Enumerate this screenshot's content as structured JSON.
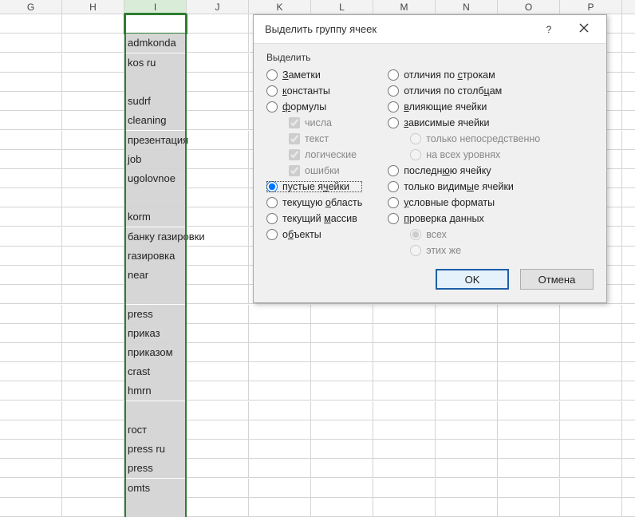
{
  "columns": [
    "G",
    "H",
    "I",
    "J",
    "K",
    "L",
    "M",
    "N",
    "O",
    "P",
    ""
  ],
  "selected_column_index": 2,
  "rows": 26,
  "cells": {
    "I": [
      "",
      "admkonda",
      "kos ru",
      "",
      "sudrf",
      "cleaning",
      "презентация",
      "job",
      "ugolovnoe",
      "",
      "korm",
      "банку газировки",
      "газировка",
      "near",
      "",
      "press",
      "приказ",
      "приказом",
      "crast",
      "hmrn",
      "",
      "гост",
      "press ru",
      "press",
      "omts",
      ""
    ]
  },
  "active_cell": {
    "col": "I",
    "row": 0
  },
  "dialog": {
    "title": "Выделить группу ячеек",
    "help": "?",
    "group_label": "Выделить",
    "left_options": [
      {
        "label": "Заметки",
        "hot": "З",
        "type": "radio",
        "checked": false
      },
      {
        "label": "константы",
        "hot": "к",
        "type": "radio",
        "checked": false
      },
      {
        "label": "формулы",
        "hot": "ф",
        "type": "radio",
        "checked": false
      },
      {
        "label": "числа",
        "type": "check",
        "indent": true,
        "checked": true,
        "disabled": true
      },
      {
        "label": "текст",
        "type": "check",
        "indent": true,
        "checked": true,
        "disabled": true
      },
      {
        "label": "логические",
        "type": "check",
        "indent": true,
        "checked": true,
        "disabled": true
      },
      {
        "label": "ошибки",
        "type": "check",
        "indent": true,
        "checked": true,
        "disabled": true
      },
      {
        "label": "пустые ячейки",
        "hot": "ч",
        "type": "radio",
        "checked": true,
        "outlined": true
      },
      {
        "label": "текущую область",
        "hot": "о",
        "type": "radio",
        "checked": false
      },
      {
        "label": "текущий массив",
        "hot": "м",
        "type": "radio",
        "checked": false
      },
      {
        "label": "объекты",
        "hot": "б",
        "type": "radio",
        "checked": false
      }
    ],
    "right_options": [
      {
        "label": "отличия по строкам",
        "hot": "с",
        "type": "radio",
        "checked": false
      },
      {
        "label": "отличия по столбцам",
        "hot": "ц",
        "type": "radio",
        "checked": false
      },
      {
        "label": "влияющие ячейки",
        "hot": "в",
        "type": "radio",
        "checked": false
      },
      {
        "label": "зависимые ячейки",
        "hot": "з",
        "type": "radio",
        "checked": false
      },
      {
        "label": "только непосредственно",
        "type": "radio",
        "indent": true,
        "checked": true,
        "disabled": true
      },
      {
        "label": "на всех уровнях",
        "type": "radio",
        "indent": true,
        "checked": false,
        "disabled": true
      },
      {
        "label": "последнюю ячейку",
        "hot": "ю",
        "type": "radio",
        "checked": false
      },
      {
        "label": "только видимые ячейки",
        "hot": "ы",
        "type": "radio",
        "checked": false
      },
      {
        "label": "условные форматы",
        "hot": "у",
        "type": "radio",
        "checked": false
      },
      {
        "label": "проверка данных",
        "hot": "п",
        "type": "radio",
        "checked": false
      },
      {
        "label": "всех",
        "type": "radio",
        "indent": true,
        "checked": true,
        "disabled": true
      },
      {
        "label": "этих же",
        "type": "radio",
        "indent": true,
        "checked": false,
        "disabled": true
      }
    ],
    "ok": "OK",
    "cancel": "Отмена"
  }
}
